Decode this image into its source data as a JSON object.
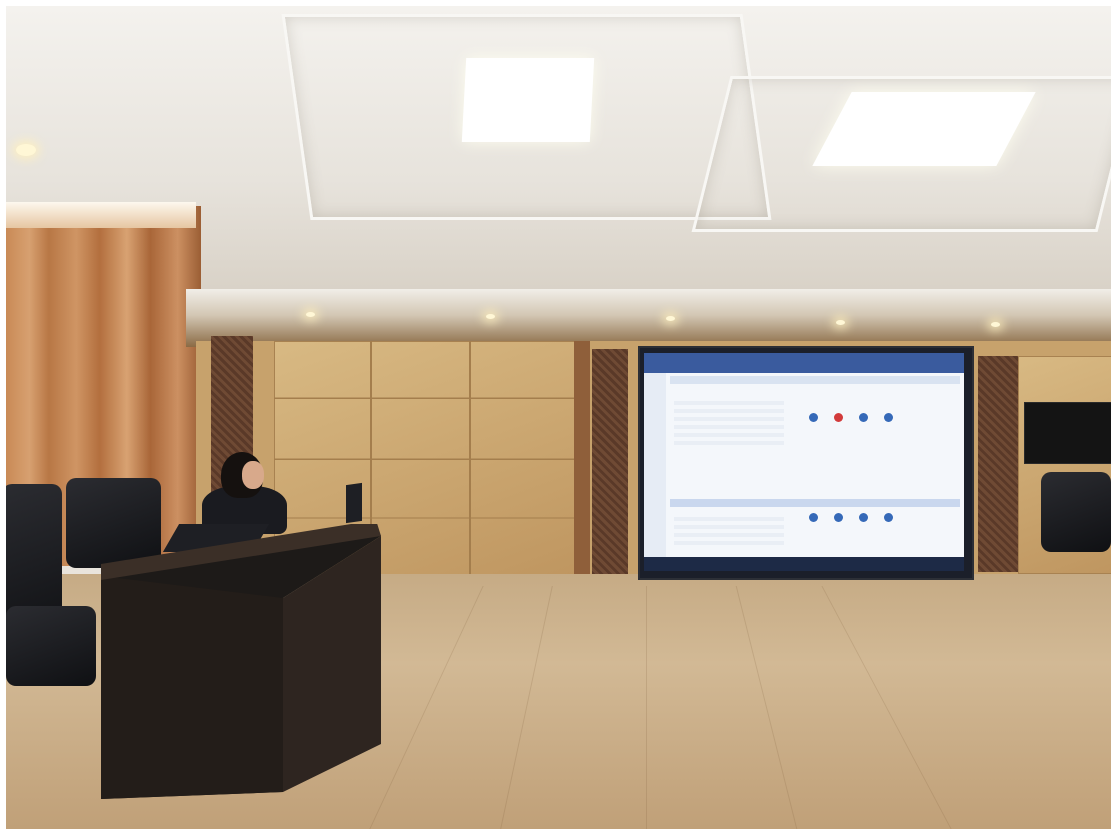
{
  "scene": {
    "subject": "conference-room-presentation",
    "elements": [
      "ceiling-lights",
      "curtains",
      "wooden-wall",
      "led-display-screen",
      "presenter-desk",
      "office-chairs",
      "wood-floor",
      "wall-tv"
    ]
  },
  "colors": {
    "ceiling": "#efebe4",
    "wall_wood": "#c7a26c",
    "floor": "#cbb28e",
    "curtain": "#c98a56",
    "screen_header": "#3a5b9e",
    "screen_body": "#f4f7fb",
    "furniture": "#1c1e23"
  }
}
